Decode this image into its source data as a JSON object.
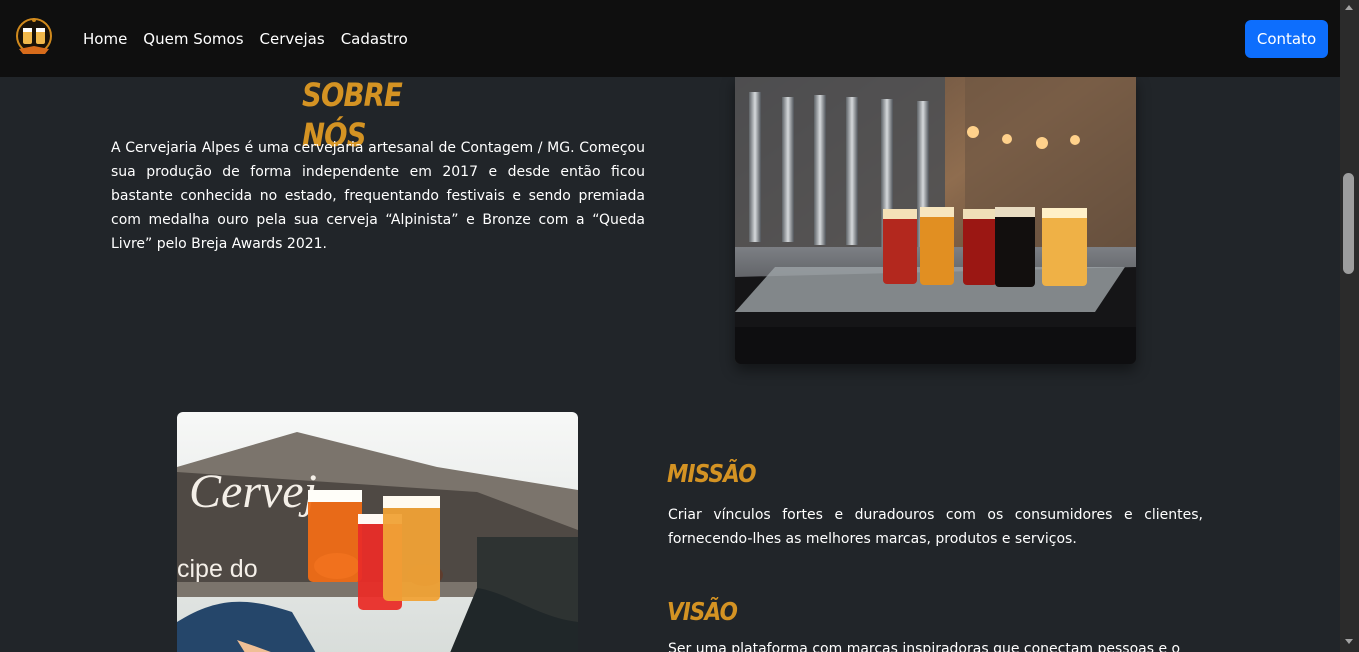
{
  "nav": {
    "links": [
      "Home",
      "Quem Somos",
      "Cervejas",
      "Cadastro"
    ],
    "contact_button": "Contato"
  },
  "about": {
    "title": "Sobre Nós",
    "text": "A Cervejaria Alpes é uma cervejaria artesanal de Contagem / MG. Começou sua produção de forma independente em 2017 e desde então ficou bastante conhecida no estado, frequentando festivais e sendo premiada com medalha ouro pela sua cerveja “Alpinista” e Bronze com a “Queda Livre” pelo Breja Awards 2021."
  },
  "mission": {
    "title": "Missão",
    "text": "Criar vínculos fortes e duradouros com os consumidores e clientes, fornecendo-lhes as melhores marcas, produtos e serviços."
  },
  "vision": {
    "title": "Visão",
    "text": "Ser uma plataforma com marcas inspiradoras que conectam pessoas e o"
  },
  "colors": {
    "accent": "#d49323",
    "primary_button": "#0d6efd",
    "background": "#212529",
    "navbar": "#0f0f0f"
  },
  "icons": {
    "logo": "beer-mugs-logo-icon"
  }
}
